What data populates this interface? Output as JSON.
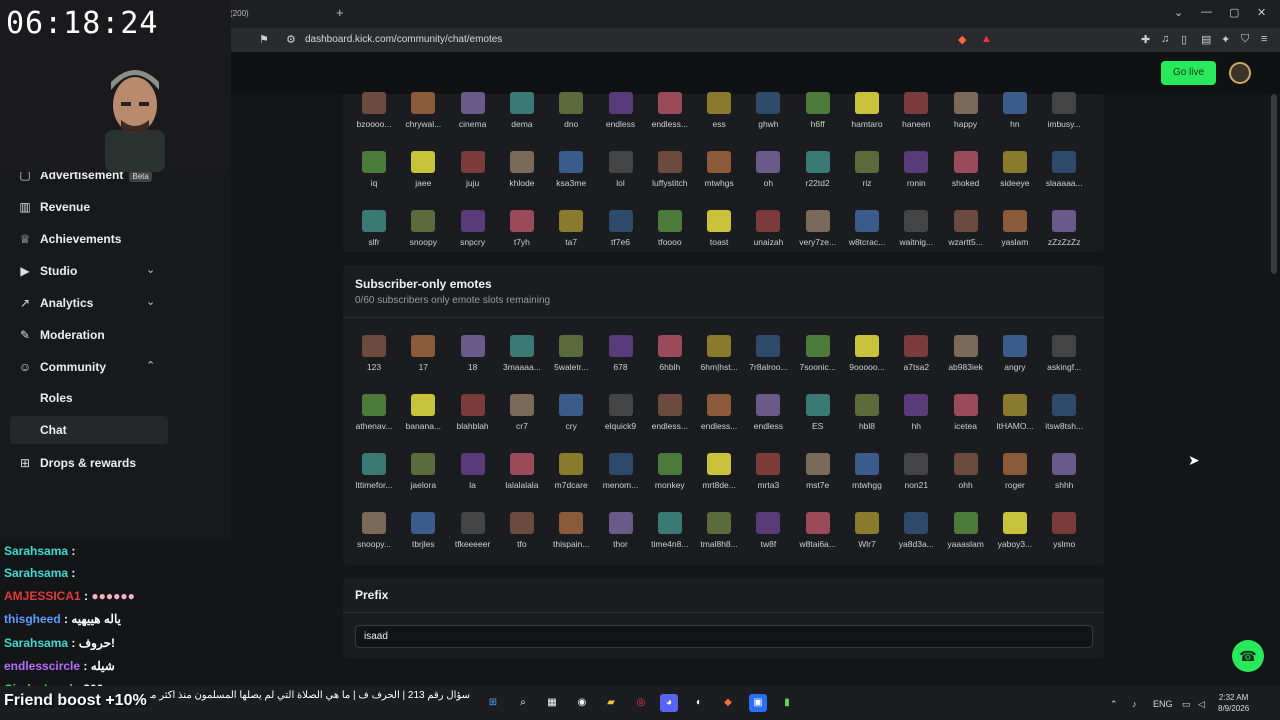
{
  "browser": {
    "tab_title": "(200)",
    "new_tab": "+",
    "url": "dashboard.kick.com/community/chat/emotes"
  },
  "header": {
    "go_live": "Go live"
  },
  "stream": {
    "timer": "06:18:24"
  },
  "sidebar": {
    "items": [
      {
        "label": "Advertisement",
        "badge": "Beta"
      },
      {
        "label": "Revenue"
      },
      {
        "label": "Achievements"
      },
      {
        "label": "Studio"
      },
      {
        "label": "Analytics"
      },
      {
        "label": "Moderation"
      },
      {
        "label": "Community"
      },
      {
        "label": "Roles"
      },
      {
        "label": "Chat"
      },
      {
        "label": "Drops & rewards"
      }
    ]
  },
  "emotes_top": [
    "bzoooo...",
    "chrywal...",
    "cinema",
    "dema",
    "dno",
    "endless",
    "endless...",
    "ess",
    "ghwh",
    "h6ff",
    "hamtaro",
    "haneen",
    "happy",
    "hn",
    "imbusy...",
    "iq",
    "jaee",
    "juju",
    "khlode",
    "ksa3me",
    "lol",
    "luffystitch",
    "mtwhgs",
    "oh",
    "r22td2",
    "riz",
    "ronin",
    "shoked",
    "sideeye",
    "slaaaaa...",
    "slfr",
    "snoopy",
    "snpcry",
    "t7yh",
    "ta7",
    "tf7e6",
    "tfoooo",
    "toast",
    "unaizah",
    "very7ze...",
    "w8tcrac...",
    "waitnig...",
    "wzartt5...",
    "yaslam",
    "zZzZzZz"
  ],
  "subscriber": {
    "title": "Subscriber-only emotes",
    "subtitle": "0/60 subscribers only emote slots remaining",
    "emotes": [
      "123",
      "17",
      "18",
      "3maaaa...",
      "5waletr...",
      "678",
      "6hblh",
      "6hm|hst...",
      "7r8alroo...",
      "7soonic...",
      "9ooooo...",
      "a7tsa2",
      "ab983iek",
      "angry",
      "askingf...",
      "athenav...",
      "banana...",
      "blahblah",
      "cr7",
      "cry",
      "elquick9",
      "endless...",
      "endless...",
      "endless",
      "ES",
      "hbl8",
      "hh",
      "icetea",
      "ItHAMO...",
      "itsw8tsh...",
      "lttimefor...",
      "jaelora",
      "la",
      "lalalalala",
      "m7dcare",
      "menom...",
      "monkey",
      "mrt8de...",
      "mrta3",
      "mst7e",
      "mtwhgg",
      "non21",
      "ohh",
      "roger",
      "shhh",
      "snoopy...",
      "tbrjles",
      "tfkeeeeer",
      "tfo",
      "thispain...",
      "thor",
      "time4n8...",
      "tmal8h8...",
      "tw8f",
      "w8tai6a...",
      "Wlr7",
      "ya8d3a...",
      "yaaaslam",
      "yaboy3...",
      "yslmo"
    ]
  },
  "prefix": {
    "title": "Prefix",
    "value": "isaad"
  },
  "chat": [
    {
      "user": "Sarahsama",
      "msg": ":"
    },
    {
      "user": "Sarahsama",
      "msg": ":"
    },
    {
      "user": "AMJESSICA1",
      "msg": ":"
    },
    {
      "user": "thisgheed",
      "msg": ": ياله هييهيه"
    },
    {
      "user": "Sarahsama",
      "msg": ": حروف!"
    },
    {
      "user": "endlesscircle",
      "msg": ": شيله"
    },
    {
      "user": "CirclesLand",
      "msg": ": 300"
    }
  ],
  "ticker": "سؤال رقم 213 | الحرف ف | ما هي الصلاة التي لم يصلها المسلمون منذ أكثر من",
  "boost": "Friend boost +10%",
  "taskbar": {
    "lang": "ENG",
    "time": "2:32 AM",
    "date": "8/9/2026"
  },
  "colors": {
    "accent": "#28e85b",
    "bg": "#141517",
    "panel": "#1b1c1f"
  }
}
